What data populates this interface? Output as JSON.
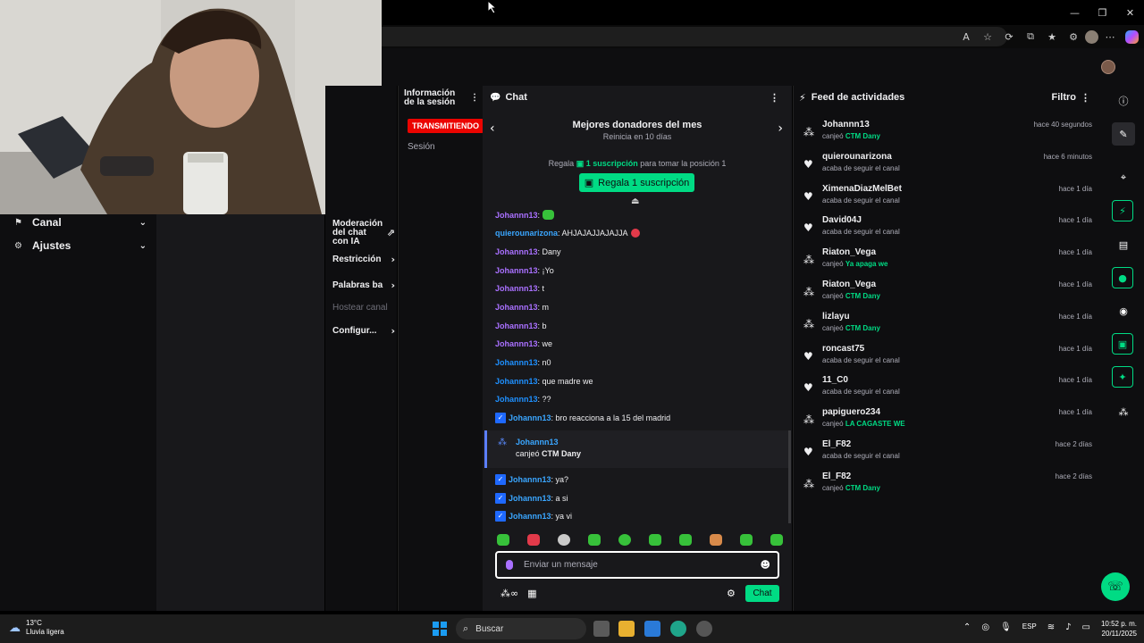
{
  "leftnav": {
    "items": [
      {
        "label": "Canal"
      },
      {
        "label": "Ajustes"
      }
    ]
  },
  "moderation": {
    "items": [
      {
        "label": "Moderación del chat con IA"
      },
      {
        "label": "Restricción"
      },
      {
        "label": "Palabras ba"
      },
      {
        "label": "Hostear canal"
      },
      {
        "label": "Configur..."
      }
    ]
  },
  "session": {
    "title": "Información de la sesión",
    "badge": "TRANSMITIENDO",
    "label": "Sesión"
  },
  "chat": {
    "title": "Chat",
    "donors_title": "Mejores donadores del mes",
    "donors_sub": "Reinicia en 10 días",
    "gift_prefix": "Regala",
    "gift_highlight": "1 suscripción",
    "gift_suffix": "para tomar la posición 1",
    "gift_button": "Regala 1 suscripción",
    "messages": [
      {
        "user": "Johannn13",
        "text": ":"
      },
      {
        "user": "quierounarizona",
        "text": ": AHJAJAJJAJAJJA"
      },
      {
        "user": "Johannn13",
        "text": ": Dany"
      },
      {
        "user": "Johannn13",
        "text": ": ¡Yo"
      },
      {
        "user": "Johannn13",
        "text": ": t"
      },
      {
        "user": "Johannn13",
        "text": ": m"
      },
      {
        "user": "Johannn13",
        "text": ": b"
      },
      {
        "user": "Johannn13",
        "text": ": we"
      },
      {
        "user": "Johannn13",
        "text": ": n0"
      },
      {
        "user": "Johannn13",
        "text": ": que madre we"
      },
      {
        "user": "Johannn13",
        "text": ": ??"
      },
      {
        "user": "Johannn13",
        "text": ": bro reacciona a la 15 del madrid"
      }
    ],
    "redeem": {
      "user": "Johannn13",
      "prefix": "canjeó",
      "reward": "CTM Dany"
    },
    "messages_after": [
      {
        "user": "Johannn13",
        "text": ": ya?"
      },
      {
        "user": "Johannn13",
        "text": ": a si"
      },
      {
        "user": "Johannn13",
        "text": ": ya vi"
      }
    ],
    "input_placeholder": "Enviar un mensaje",
    "send_label": "Chat",
    "points_glyph": "∞"
  },
  "feed": {
    "title": "Feed de actividades",
    "filter": "Filtro",
    "items": [
      {
        "icon": "points",
        "name": "Johannn13",
        "prefix": "canjeó",
        "reward": "CTM Dany",
        "time": "hace 40 segundos"
      },
      {
        "icon": "heart",
        "name": "quierounarizona",
        "prefix": "acaba de seguir el canal",
        "reward": "",
        "time": "hace 6 minutos"
      },
      {
        "icon": "heart",
        "name": "XimenaDiazMelBet",
        "prefix": "acaba de seguir el canal",
        "reward": "",
        "time": "hace 1 día"
      },
      {
        "icon": "heart",
        "name": "David04J",
        "prefix": "acaba de seguir el canal",
        "reward": "",
        "time": "hace 1 día"
      },
      {
        "icon": "points",
        "name": "Riaton_Vega",
        "prefix": "canjeó",
        "reward": "Ya apaga we",
        "time": "hace 1 día"
      },
      {
        "icon": "points",
        "name": "Riaton_Vega",
        "prefix": "canjeó",
        "reward": "CTM Dany",
        "time": "hace 1 día"
      },
      {
        "icon": "points",
        "name": "lizlayu",
        "prefix": "canjeó",
        "reward": "CTM Dany",
        "time": "hace 1 día"
      },
      {
        "icon": "heart",
        "name": "roncast75",
        "prefix": "acaba de seguir el canal",
        "reward": "",
        "time": "hace 1 día"
      },
      {
        "icon": "heart",
        "name": "11_C0",
        "prefix": "acaba de seguir el canal",
        "reward": "",
        "time": "hace 1 día"
      },
      {
        "icon": "points",
        "name": "papiguero234",
        "prefix": "canjeó",
        "reward": "LA CAGASTE WE",
        "time": "hace 1 día"
      },
      {
        "icon": "heart",
        "name": "El_F82",
        "prefix": "acaba de seguir el canal",
        "reward": "",
        "time": "hace 2 días"
      },
      {
        "icon": "points",
        "name": "El_F82",
        "prefix": "canjeó",
        "reward": "CTM Dany",
        "time": "hace 2 días"
      }
    ]
  },
  "taskbar": {
    "temperature": "13°C",
    "weather": "Lluvia ligera",
    "search_label": "Buscar",
    "language": "ESP",
    "time": "10:52 p. m.",
    "date": "20/11/2025"
  },
  "colors": {
    "accent_green": "#00db84",
    "live_red": "#eb0400",
    "username_purple": "#a970ff",
    "username_blue": "#1e90ff"
  }
}
